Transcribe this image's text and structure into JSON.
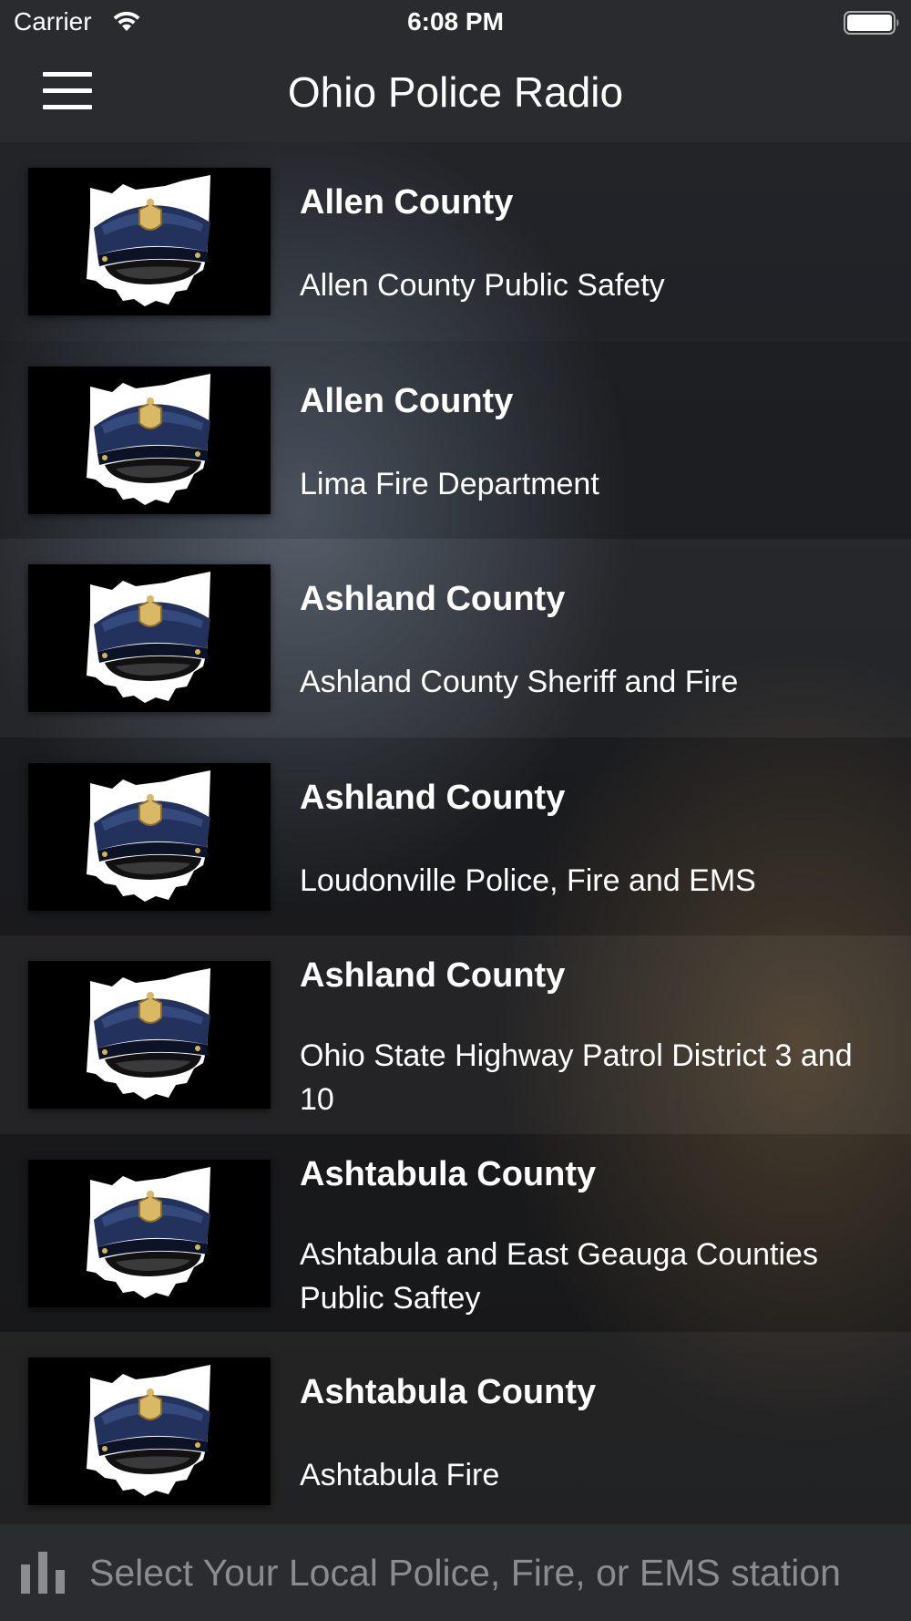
{
  "status_bar": {
    "carrier": "Carrier",
    "time": "6:08 PM",
    "icons": [
      "wifi-icon",
      "battery-icon"
    ]
  },
  "nav_bar": {
    "title": "Ohio Police Radio",
    "menu_icon": "hamburger-menu-icon"
  },
  "stations": [
    {
      "title": "Allen County",
      "subtitle": "Allen County Public Safety",
      "icon": "ohio-police-cap-icon"
    },
    {
      "title": "Allen County",
      "subtitle": "Lima Fire Department",
      "icon": "ohio-police-cap-icon"
    },
    {
      "title": "Ashland County",
      "subtitle": "Ashland County Sheriff and Fire",
      "icon": "ohio-police-cap-icon"
    },
    {
      "title": "Ashland County",
      "subtitle": "Loudonville Police, Fire and EMS",
      "icon": "ohio-police-cap-icon"
    },
    {
      "title": "Ashland County",
      "subtitle": "Ohio State Highway Patrol District 3 and 10",
      "icon": "ohio-police-cap-icon"
    },
    {
      "title": "Ashtabula County",
      "subtitle": "Ashtabula and East Geauga Counties Public Saftey",
      "icon": "ohio-police-cap-icon"
    },
    {
      "title": "Ashtabula County",
      "subtitle": "Ashtabula Fire",
      "icon": "ohio-police-cap-icon"
    }
  ],
  "footer": {
    "text": "Select Your Local Police, Fire, or EMS station",
    "icon": "equalizer-bars-icon",
    "text_color": "#8c8c90"
  },
  "colors": {
    "bar_background": "#2a2b2f",
    "text": "#ffffff"
  }
}
